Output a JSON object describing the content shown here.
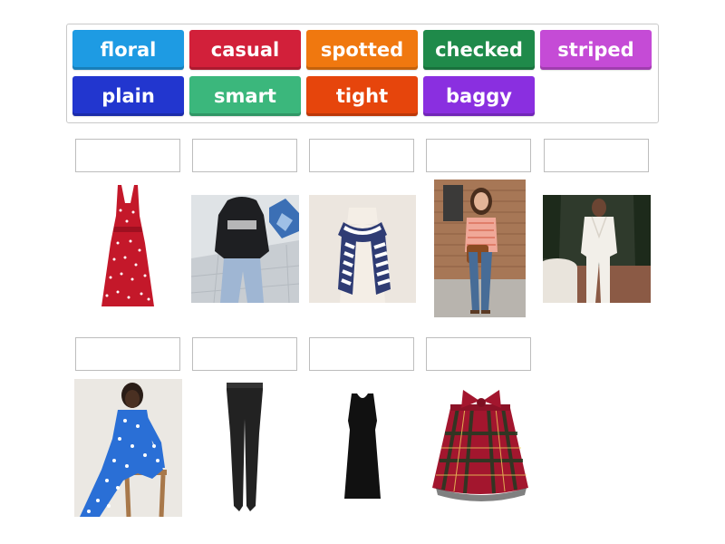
{
  "word_bank": {
    "tiles": [
      {
        "label": "floral",
        "color": "#1e9be3"
      },
      {
        "label": "casual",
        "color": "#d2203a"
      },
      {
        "label": "spotted",
        "color": "#f0780f"
      },
      {
        "label": "checked",
        "color": "#1f8a4a"
      },
      {
        "label": "striped",
        "color": "#c54bd6"
      },
      {
        "label": "plain",
        "color": "#2236cf"
      },
      {
        "label": "smart",
        "color": "#3bb77c"
      },
      {
        "label": "tight",
        "color": "#e6450c"
      },
      {
        "label": "baggy",
        "color": "#8a2fe0"
      }
    ]
  },
  "answer_slots": [
    {
      "value": ""
    },
    {
      "value": ""
    },
    {
      "value": ""
    },
    {
      "value": ""
    },
    {
      "value": ""
    },
    {
      "value": ""
    },
    {
      "value": ""
    },
    {
      "value": ""
    },
    {
      "value": ""
    }
  ],
  "pictures": [
    {
      "icon": "red-polka-dot-dress-photo"
    },
    {
      "icon": "baggy-hoodie-jeans-photo"
    },
    {
      "icon": "striped-scarf-photo"
    },
    {
      "icon": "casual-outfit-woman-photo"
    },
    {
      "icon": "white-suit-photo"
    },
    {
      "icon": "blue-floral-dress-photo"
    },
    {
      "icon": "black-leggings-photo"
    },
    {
      "icon": "black-plain-dress-photo"
    },
    {
      "icon": "tartan-skirt-photo"
    }
  ]
}
